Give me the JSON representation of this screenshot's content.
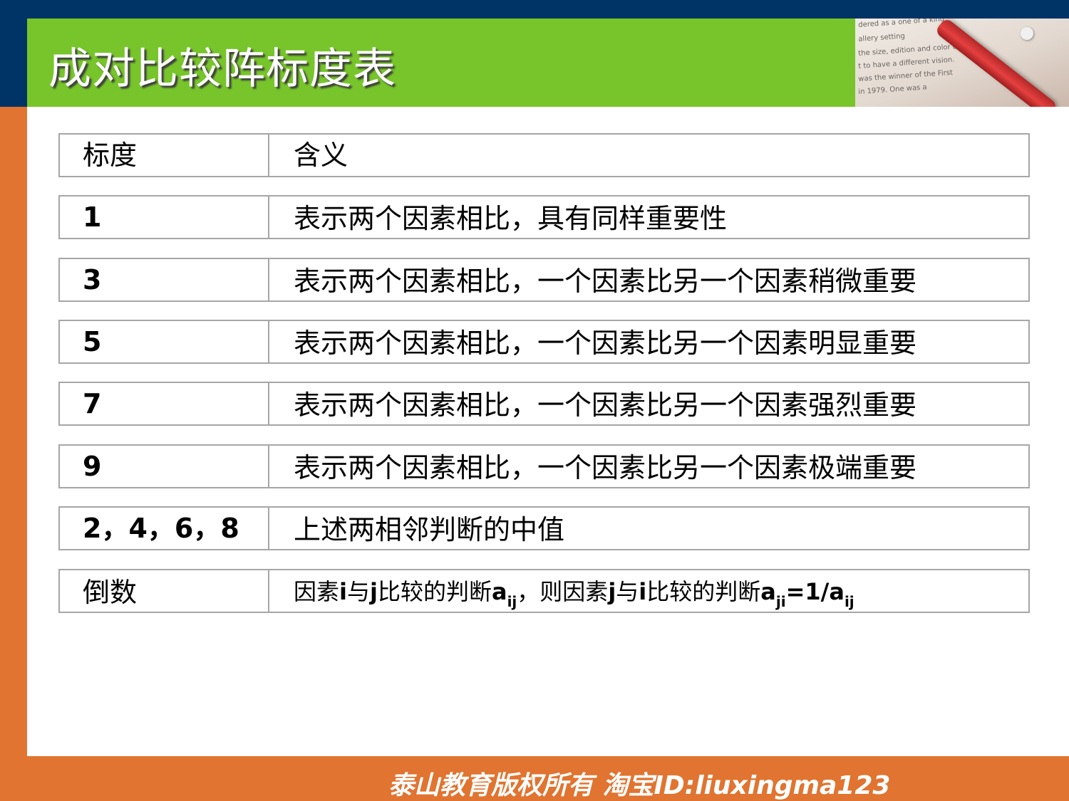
{
  "title": "成对比较阵标度表",
  "corner_photo": {
    "text_lines": [
      "dered as  a one of a kind",
      "allery setting",
      "the size, edition and color of th",
      "t to have a different vision.",
      "was the winner of the First",
      "in 1979.  One was a"
    ]
  },
  "table": {
    "header": {
      "scale": "标度",
      "meaning": "含义"
    },
    "rows": [
      {
        "scale": "1",
        "meaning": "表示两个因素相比，具有同样重要性"
      },
      {
        "scale": "3",
        "meaning": "表示两个因素相比，一个因素比另一个因素稍微重要"
      },
      {
        "scale": "5",
        "meaning": "表示两个因素相比，一个因素比另一个因素明显重要"
      },
      {
        "scale": "7",
        "meaning": "表示两个因素相比，一个因素比另一个因素强烈重要"
      },
      {
        "scale": "9",
        "meaning": "表示两个因素相比，一个因素比另一个因素极端重要"
      },
      {
        "scale": "2，4，6，8",
        "meaning": "上述两相邻判断的中值"
      }
    ],
    "reciprocal": {
      "scale": "倒数",
      "parts": {
        "p1": "因素",
        "i": "i",
        "p2": "与",
        "j": "j",
        "p3": "比较的判断",
        "a": "a",
        "sub_ij": "ij",
        "p4": "，则因素",
        "p5": "比较的判断",
        "sub_ji": "ji",
        "eq": "=1/"
      }
    }
  },
  "footer": "泰山教育版权所有  淘宝ID:liuxingma123",
  "colors": {
    "navy": "#003366",
    "green": "#77c52a",
    "orange": "#e07430",
    "border": "#a6a6a6"
  }
}
